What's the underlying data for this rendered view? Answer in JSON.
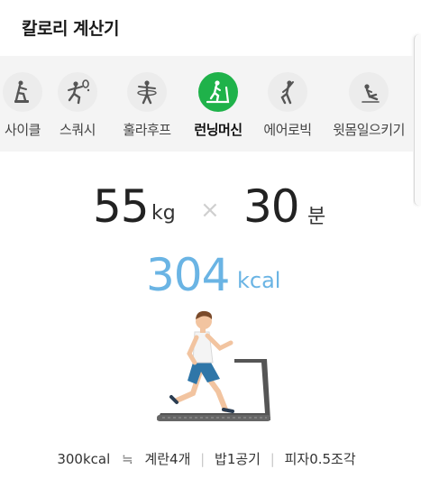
{
  "app": {
    "title": "칼로리 계산기"
  },
  "tabs": [
    {
      "label": "사이클",
      "icon": "cycle-icon"
    },
    {
      "label": "스쿼시",
      "icon": "squash-icon"
    },
    {
      "label": "훌라후프",
      "icon": "hula-hoop-icon"
    },
    {
      "label": "런닝머신",
      "icon": "treadmill-icon",
      "active": true
    },
    {
      "label": "에어로빅",
      "icon": "aerobics-icon"
    },
    {
      "label": "윗몸일으키기",
      "icon": "situp-icon"
    }
  ],
  "calc": {
    "weight_value": "55",
    "weight_unit": "kg",
    "times_symbol": "×",
    "time_value": "30",
    "time_unit": "분",
    "kcal_value": "304",
    "kcal_unit": "kcal"
  },
  "equivalents": {
    "kcal": "300kcal",
    "approx": "≒",
    "items": [
      "계란4개",
      "밥1공기",
      "피자0.5조각"
    ]
  },
  "colors": {
    "active_tab": "#1fb24a",
    "kcal": "#6ab4e4",
    "tab_bg": "#f4f4f4"
  }
}
